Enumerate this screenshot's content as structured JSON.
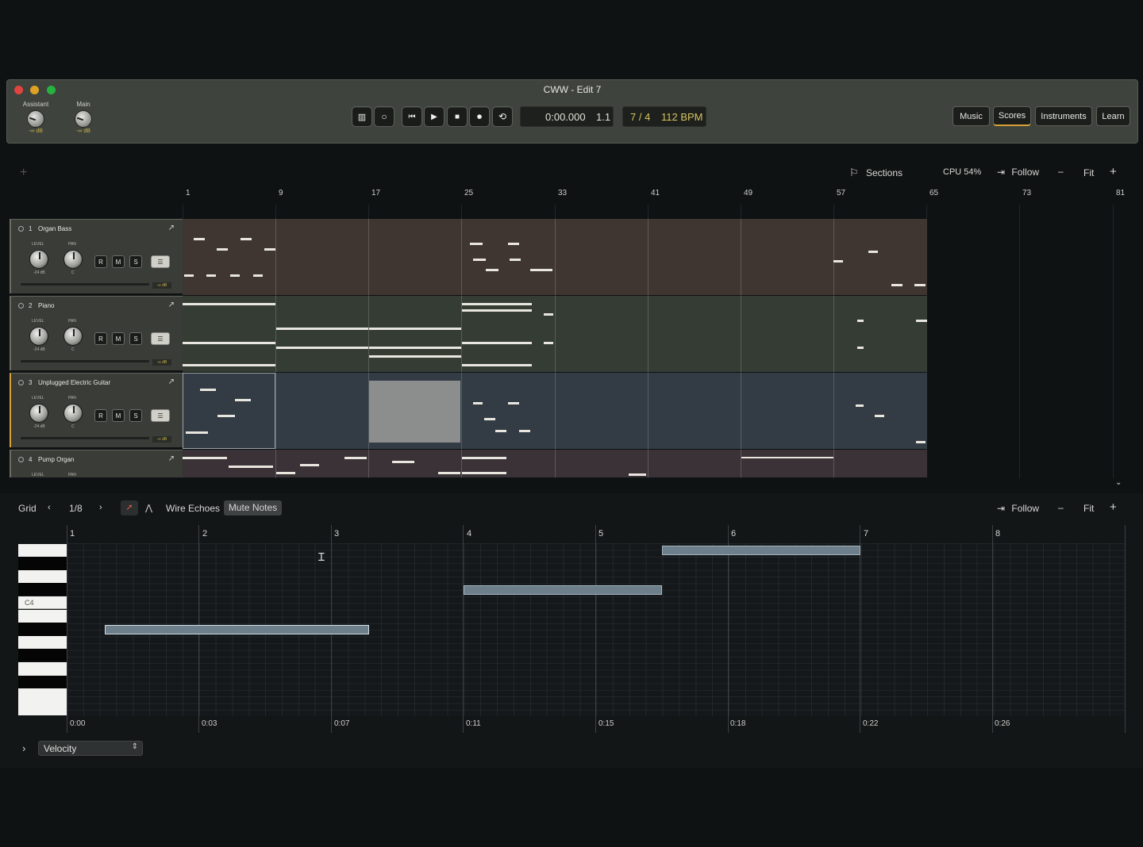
{
  "window": {
    "title": "CWW - Edit 7"
  },
  "master": {
    "knobs": [
      {
        "label": "Assistant",
        "value": "-∞ dB"
      },
      {
        "label": "Main",
        "value": "-∞ dB"
      }
    ]
  },
  "transport": {
    "time": "0:00.000",
    "position": "1.1",
    "time_signature": "7 / 4",
    "tempo": "112 BPM"
  },
  "modes": [
    "Music",
    "Scores",
    "Instruments",
    "Learn"
  ],
  "arranger": {
    "toolbar": {
      "sections": "Sections",
      "cpu": "CPU 54%",
      "follow": "Follow",
      "zoom_out": "–",
      "fit": "Fit",
      "zoom_in": "+",
      "add": "+"
    },
    "ruler": [
      "1",
      "9",
      "17",
      "25",
      "33",
      "41",
      "49",
      "57",
      "65",
      "73",
      "81"
    ],
    "tracks": [
      {
        "num": "1",
        "name": "Organ Bass",
        "level_label": "LEVEL",
        "pan_label": "PAN",
        "level": "-24 dB",
        "pan": "C",
        "r": "R",
        "m": "M",
        "s": "S",
        "db": "-∞ dB"
      },
      {
        "num": "2",
        "name": "Piano",
        "level_label": "LEVEL",
        "pan_label": "PAN",
        "level": "-24 dB",
        "pan": "C",
        "r": "R",
        "m": "M",
        "s": "S",
        "db": "-∞ dB"
      },
      {
        "num": "3",
        "name": "Unplugged Electric Guitar",
        "level_label": "LEVEL",
        "pan_label": "PAN",
        "level": "-24 dB",
        "pan": "C",
        "r": "R",
        "m": "M",
        "s": "S",
        "db": "-∞ dB"
      },
      {
        "num": "4",
        "name": "Pump Organ",
        "level_label": "LEVEL",
        "pan_label": "PAN"
      }
    ],
    "colors": {
      "organ_bass": "#3f3531",
      "piano": "#353c34",
      "guitar": "#333c44",
      "pump_organ": "#3a3236"
    }
  },
  "editor": {
    "grid_label": "Grid",
    "grid_value": "1/8",
    "wire_echoes": "Wire Echoes",
    "mute_notes": "Mute Notes",
    "follow": "Follow",
    "zoom_out": "–",
    "fit": "Fit",
    "zoom_in": "+",
    "bars": [
      "1",
      "2",
      "3",
      "4",
      "5",
      "6",
      "7",
      "8"
    ],
    "times": [
      "0:00",
      "0:03",
      "0:07",
      "0:11",
      "0:15",
      "0:18",
      "0:22",
      "0:26"
    ],
    "key_label": "C4",
    "lane_select": "Velocity"
  }
}
